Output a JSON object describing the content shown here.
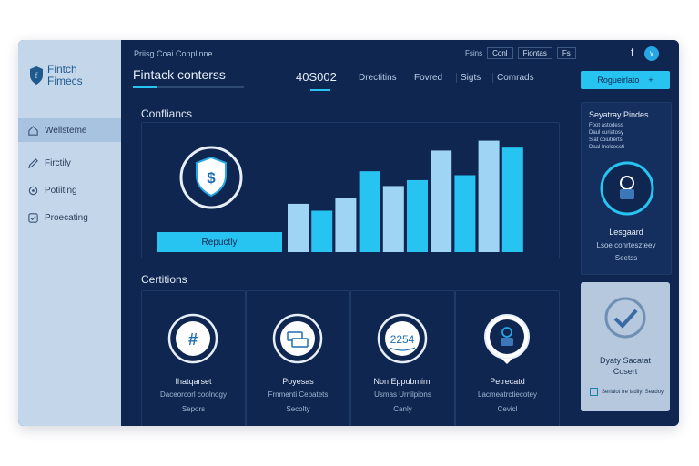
{
  "sidebar": {
    "brand_line1": "Fintch",
    "brand_line2": "Fimecs",
    "items": [
      {
        "label": "Wellsteme",
        "icon": "home-icon",
        "active": true
      },
      {
        "label": "Firctily",
        "icon": "edit-icon"
      },
      {
        "label": "Potiiting",
        "icon": "settings-icon"
      },
      {
        "label": "Proecating",
        "icon": "check-icon"
      }
    ]
  },
  "header": {
    "breadcrumb": "Priisg Coai Conplinne",
    "app_title": "Fintack conterss",
    "code": "40S002",
    "tabs": [
      "Drectitins",
      "Fovred",
      "Sigts",
      "Comrads"
    ],
    "top_label": "Fsins",
    "top_box1": "Conl",
    "top_box2": "Fiontas",
    "top_box3": "Fs",
    "f_icon": "f",
    "avatar": "v",
    "register_button": "Rogueirlato",
    "register_button_icon": "+"
  },
  "compliance": {
    "title": "Confliancs",
    "request_label": "Repuctly",
    "chart_data": {
      "type": "bar",
      "values": [
        4.9,
        4.2,
        5.5,
        8.2,
        6.7,
        7.3,
        10.3,
        7.8,
        11.3,
        10.6
      ],
      "ylim": [
        0,
        12
      ]
    }
  },
  "certifications": {
    "title": "Certitions",
    "cards": [
      {
        "icon": "hash-icon",
        "t1": "Ihatqarset",
        "t2": "Daceorcorl coolnogy",
        "t3": "Sepors"
      },
      {
        "icon": "card-icon",
        "t1": "Poyesas",
        "t2": "Frnmenti Cepatets",
        "t3": "Secolty"
      },
      {
        "icon": "certificate-icon",
        "badge": "2254",
        "t1": "Non Eppubmiml",
        "t2": "Usmas Urnilpions",
        "t3": "Canly"
      },
      {
        "icon": "user-pin-icon",
        "t1": "Petrecatd",
        "t2": "Lacmeatrctiecotey",
        "t3": "Cevicl"
      }
    ]
  },
  "right_panel": {
    "title": "Seyatray Pindes",
    "items": [
      "Foot astodess",
      "Daul curiatosy",
      "Slat coiutrerts",
      "Daal Inolcoscti"
    ],
    "status1": "Lesgaard",
    "status2": "Lsoe conrteszteey",
    "status3": "Seetss"
  },
  "verified_panel": {
    "title_line1": "Dyaty Sacatat",
    "title_line2": "Cosert",
    "footer": "Seriaiot fre ladliyf Seadoy"
  },
  "colors": {
    "accent": "#27c4f2",
    "navy": "#0f2650",
    "sidebar": "#c4d7ea"
  }
}
